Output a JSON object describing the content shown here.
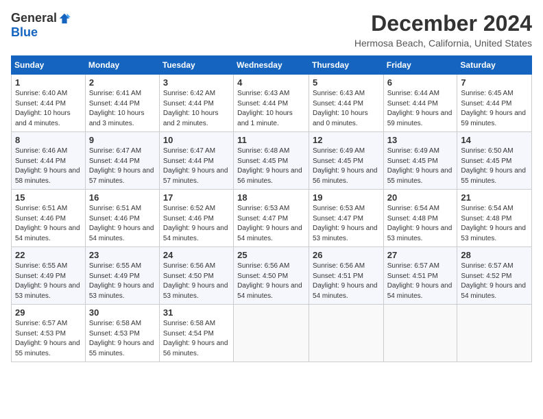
{
  "logo": {
    "general": "General",
    "blue": "Blue"
  },
  "title": "December 2024",
  "location": "Hermosa Beach, California, United States",
  "days_of_week": [
    "Sunday",
    "Monday",
    "Tuesday",
    "Wednesday",
    "Thursday",
    "Friday",
    "Saturday"
  ],
  "weeks": [
    [
      {
        "day": "1",
        "sunrise": "Sunrise: 6:40 AM",
        "sunset": "Sunset: 4:44 PM",
        "daylight": "Daylight: 10 hours and 4 minutes."
      },
      {
        "day": "2",
        "sunrise": "Sunrise: 6:41 AM",
        "sunset": "Sunset: 4:44 PM",
        "daylight": "Daylight: 10 hours and 3 minutes."
      },
      {
        "day": "3",
        "sunrise": "Sunrise: 6:42 AM",
        "sunset": "Sunset: 4:44 PM",
        "daylight": "Daylight: 10 hours and 2 minutes."
      },
      {
        "day": "4",
        "sunrise": "Sunrise: 6:43 AM",
        "sunset": "Sunset: 4:44 PM",
        "daylight": "Daylight: 10 hours and 1 minute."
      },
      {
        "day": "5",
        "sunrise": "Sunrise: 6:43 AM",
        "sunset": "Sunset: 4:44 PM",
        "daylight": "Daylight: 10 hours and 0 minutes."
      },
      {
        "day": "6",
        "sunrise": "Sunrise: 6:44 AM",
        "sunset": "Sunset: 4:44 PM",
        "daylight": "Daylight: 9 hours and 59 minutes."
      },
      {
        "day": "7",
        "sunrise": "Sunrise: 6:45 AM",
        "sunset": "Sunset: 4:44 PM",
        "daylight": "Daylight: 9 hours and 59 minutes."
      }
    ],
    [
      {
        "day": "8",
        "sunrise": "Sunrise: 6:46 AM",
        "sunset": "Sunset: 4:44 PM",
        "daylight": "Daylight: 9 hours and 58 minutes."
      },
      {
        "day": "9",
        "sunrise": "Sunrise: 6:47 AM",
        "sunset": "Sunset: 4:44 PM",
        "daylight": "Daylight: 9 hours and 57 minutes."
      },
      {
        "day": "10",
        "sunrise": "Sunrise: 6:47 AM",
        "sunset": "Sunset: 4:44 PM",
        "daylight": "Daylight: 9 hours and 57 minutes."
      },
      {
        "day": "11",
        "sunrise": "Sunrise: 6:48 AM",
        "sunset": "Sunset: 4:45 PM",
        "daylight": "Daylight: 9 hours and 56 minutes."
      },
      {
        "day": "12",
        "sunrise": "Sunrise: 6:49 AM",
        "sunset": "Sunset: 4:45 PM",
        "daylight": "Daylight: 9 hours and 56 minutes."
      },
      {
        "day": "13",
        "sunrise": "Sunrise: 6:49 AM",
        "sunset": "Sunset: 4:45 PM",
        "daylight": "Daylight: 9 hours and 55 minutes."
      },
      {
        "day": "14",
        "sunrise": "Sunrise: 6:50 AM",
        "sunset": "Sunset: 4:45 PM",
        "daylight": "Daylight: 9 hours and 55 minutes."
      }
    ],
    [
      {
        "day": "15",
        "sunrise": "Sunrise: 6:51 AM",
        "sunset": "Sunset: 4:46 PM",
        "daylight": "Daylight: 9 hours and 54 minutes."
      },
      {
        "day": "16",
        "sunrise": "Sunrise: 6:51 AM",
        "sunset": "Sunset: 4:46 PM",
        "daylight": "Daylight: 9 hours and 54 minutes."
      },
      {
        "day": "17",
        "sunrise": "Sunrise: 6:52 AM",
        "sunset": "Sunset: 4:46 PM",
        "daylight": "Daylight: 9 hours and 54 minutes."
      },
      {
        "day": "18",
        "sunrise": "Sunrise: 6:53 AM",
        "sunset": "Sunset: 4:47 PM",
        "daylight": "Daylight: 9 hours and 54 minutes."
      },
      {
        "day": "19",
        "sunrise": "Sunrise: 6:53 AM",
        "sunset": "Sunset: 4:47 PM",
        "daylight": "Daylight: 9 hours and 53 minutes."
      },
      {
        "day": "20",
        "sunrise": "Sunrise: 6:54 AM",
        "sunset": "Sunset: 4:48 PM",
        "daylight": "Daylight: 9 hours and 53 minutes."
      },
      {
        "day": "21",
        "sunrise": "Sunrise: 6:54 AM",
        "sunset": "Sunset: 4:48 PM",
        "daylight": "Daylight: 9 hours and 53 minutes."
      }
    ],
    [
      {
        "day": "22",
        "sunrise": "Sunrise: 6:55 AM",
        "sunset": "Sunset: 4:49 PM",
        "daylight": "Daylight: 9 hours and 53 minutes."
      },
      {
        "day": "23",
        "sunrise": "Sunrise: 6:55 AM",
        "sunset": "Sunset: 4:49 PM",
        "daylight": "Daylight: 9 hours and 53 minutes."
      },
      {
        "day": "24",
        "sunrise": "Sunrise: 6:56 AM",
        "sunset": "Sunset: 4:50 PM",
        "daylight": "Daylight: 9 hours and 53 minutes."
      },
      {
        "day": "25",
        "sunrise": "Sunrise: 6:56 AM",
        "sunset": "Sunset: 4:50 PM",
        "daylight": "Daylight: 9 hours and 54 minutes."
      },
      {
        "day": "26",
        "sunrise": "Sunrise: 6:56 AM",
        "sunset": "Sunset: 4:51 PM",
        "daylight": "Daylight: 9 hours and 54 minutes."
      },
      {
        "day": "27",
        "sunrise": "Sunrise: 6:57 AM",
        "sunset": "Sunset: 4:51 PM",
        "daylight": "Daylight: 9 hours and 54 minutes."
      },
      {
        "day": "28",
        "sunrise": "Sunrise: 6:57 AM",
        "sunset": "Sunset: 4:52 PM",
        "daylight": "Daylight: 9 hours and 54 minutes."
      }
    ],
    [
      {
        "day": "29",
        "sunrise": "Sunrise: 6:57 AM",
        "sunset": "Sunset: 4:53 PM",
        "daylight": "Daylight: 9 hours and 55 minutes."
      },
      {
        "day": "30",
        "sunrise": "Sunrise: 6:58 AM",
        "sunset": "Sunset: 4:53 PM",
        "daylight": "Daylight: 9 hours and 55 minutes."
      },
      {
        "day": "31",
        "sunrise": "Sunrise: 6:58 AM",
        "sunset": "Sunset: 4:54 PM",
        "daylight": "Daylight: 9 hours and 56 minutes."
      },
      null,
      null,
      null,
      null
    ]
  ]
}
